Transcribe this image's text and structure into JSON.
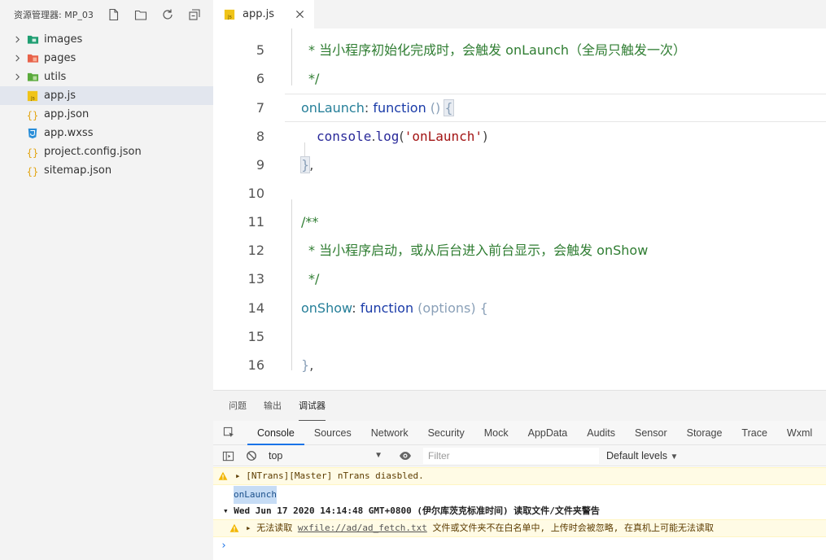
{
  "sidebar": {
    "title": "资源管理器: MP_03",
    "header_icons": [
      "new-file-icon",
      "new-folder-icon",
      "refresh-icon",
      "collapse-all-icon"
    ],
    "items": [
      {
        "label": "images",
        "type": "folder",
        "icon": "folder-images-icon",
        "color": "#1f9e72"
      },
      {
        "label": "pages",
        "type": "folder",
        "icon": "folder-pages-icon",
        "color": "#e8624a"
      },
      {
        "label": "utils",
        "type": "folder",
        "icon": "folder-utils-icon",
        "color": "#5aaa3c"
      },
      {
        "label": "app.js",
        "type": "js",
        "icon": "js-file-icon",
        "selected": true
      },
      {
        "label": "app.json",
        "type": "json",
        "icon": "json-file-icon"
      },
      {
        "label": "app.wxss",
        "type": "wxss",
        "icon": "css-file-icon"
      },
      {
        "label": "project.config.json",
        "type": "json",
        "icon": "json-file-icon"
      },
      {
        "label": "sitemap.json",
        "type": "json",
        "icon": "json-file-icon"
      }
    ]
  },
  "editor": {
    "tab_label": "app.js",
    "lines": [
      {
        "n": "5",
        "comment": "* 当小程序初始化完成时，会触发 onLaunch（全局只触发一次）"
      },
      {
        "n": "6",
        "comment": "*/"
      },
      {
        "n": "7",
        "prop": "onLaunch",
        "colon": ": ",
        "kw": "function",
        "paren": " () ",
        "brace": "{"
      },
      {
        "n": "8",
        "obj": "console",
        "dot": ".",
        "fn": "log",
        "open": "(",
        "str": "'onLaunch'",
        "close": ")"
      },
      {
        "n": "9",
        "brace": "}",
        "comma": ","
      },
      {
        "n": "10"
      },
      {
        "n": "11",
        "comment": "/**"
      },
      {
        "n": "12",
        "comment": "* 当小程序启动，或从后台进入前台显示，会触发 onShow"
      },
      {
        "n": "13",
        "comment": "*/"
      },
      {
        "n": "14",
        "prop": "onShow",
        "colon": ": ",
        "kw": "function",
        "paren": " (options) ",
        "brace": "{"
      },
      {
        "n": "15"
      },
      {
        "n": "16",
        "brace": "}",
        "comma": ","
      }
    ]
  },
  "panel": {
    "tabs": [
      "问题",
      "输出",
      "调试器"
    ],
    "active_tab": "调试器"
  },
  "devtools": {
    "tabs": [
      "Console",
      "Sources",
      "Network",
      "Security",
      "Mock",
      "AppData",
      "Audits",
      "Sensor",
      "Storage",
      "Trace",
      "Wxml"
    ],
    "active_tab": "Console",
    "context": "top",
    "filter_placeholder": "Filter",
    "levels": "Default levels",
    "messages": {
      "m1": "▸ [NTrans][Master] nTrans diasbled.",
      "m2": "onLaunch",
      "m3": "▾ Wed Jun 17 2020 14:14:48 GMT+0800 (伊尔库茨克标准时间) 读取文件/文件夹警告",
      "m4_pre": "▸ 无法读取 ",
      "m4_link": "wxfile://ad/ad_fetch.txt",
      "m4_post": " 文件或文件夹不在白名单中, 上传时会被忽略, 在真机上可能无法读取",
      "prompt": "›"
    }
  },
  "colors": {
    "accent": "#1a73e8",
    "warning_bg": "#fffbe5",
    "selection": "#e2e6ee"
  }
}
